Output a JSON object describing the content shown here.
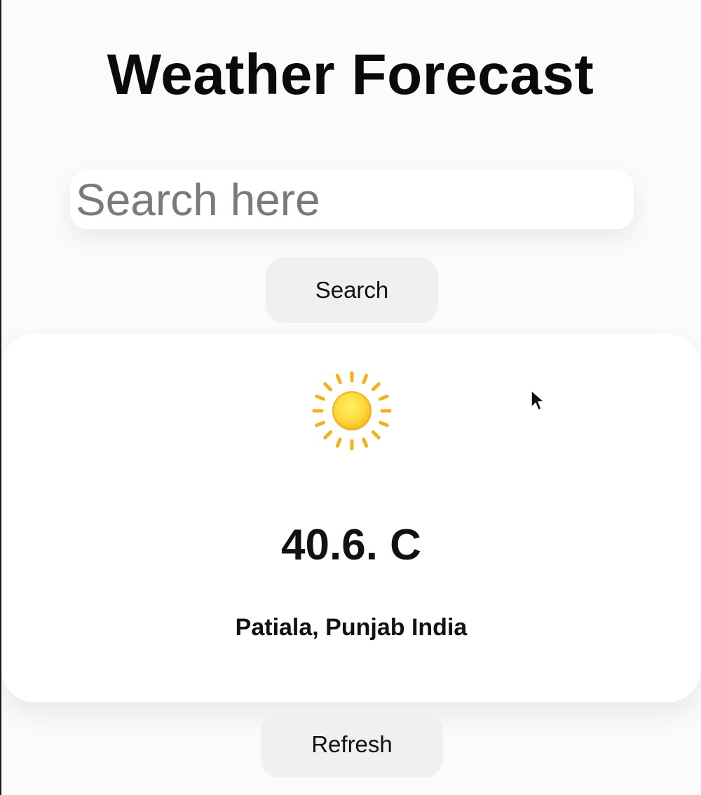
{
  "app": {
    "title": "Weather Forecast"
  },
  "search": {
    "placeholder": "Search here",
    "value": "",
    "button_label": "Search"
  },
  "weather": {
    "icon": "sun-icon",
    "temperature": "40.6. C",
    "location": "Patiala, Punjab India"
  },
  "actions": {
    "refresh_label": "Refresh"
  },
  "colors": {
    "background": "#fbfbfb",
    "card": "#ffffff",
    "button": "#f0f0f0",
    "text": "#111111",
    "placeholder": "#7a7a7a",
    "sun_center": "#ffd83a",
    "sun_rays": "#f2b11f"
  }
}
